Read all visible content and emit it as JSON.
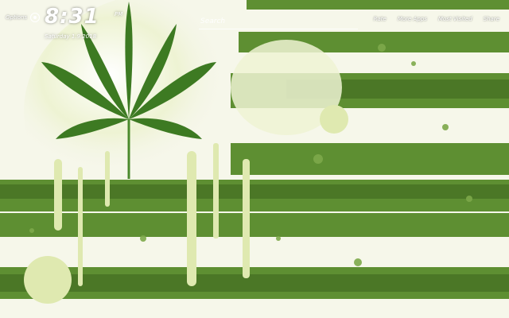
{
  "header": {
    "options_label": "Options",
    "time": "8:31",
    "ampm": "PM",
    "date": "Saturday 1.9.2018",
    "search_placeholder": "Search",
    "nav": [
      "Rate",
      "More Apps",
      "Most Visited",
      "Share"
    ]
  },
  "wallpaper": {
    "subject": "green and white striped flag with a cannabis leaf and paint splatter",
    "colors": {
      "stripe": "#5e8f32",
      "stripe_dark": "#467023",
      "background": "#f4f5e8",
      "glow": "#dfe9b0",
      "leaf": "#3d7a22"
    }
  }
}
